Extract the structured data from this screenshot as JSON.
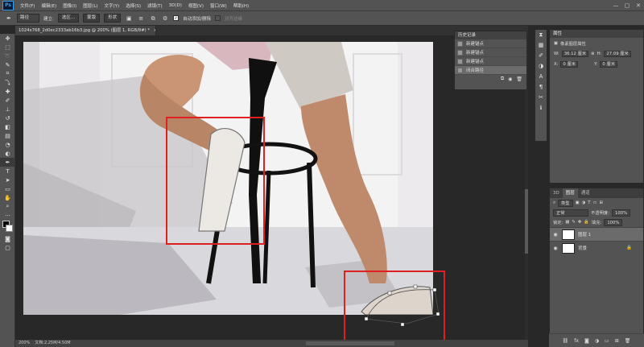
{
  "app": {
    "logo": "Ps"
  },
  "menu": [
    "文件(F)",
    "编辑(E)",
    "图像(I)",
    "图层(L)",
    "文字(Y)",
    "选择(S)",
    "滤镜(T)",
    "3D(D)",
    "视图(V)",
    "窗口(W)",
    "帮助(H)"
  ],
  "window_controls": [
    "—",
    "▢",
    "✕"
  ],
  "options": {
    "mode": "路径",
    "make_label": "建立:",
    "selection_btn": "选区...",
    "mask_btn": "蒙版",
    "shape_btn": "形状",
    "auto_add_delete": "自动添加/删除",
    "align_edges": "对齐边缘"
  },
  "document": {
    "tab_title": "1024x768_2d0ec2333ab16b3.jpg @ 200% (图层 1, RGB/8#) *",
    "tab_close": "×"
  },
  "status": {
    "zoom": "200%",
    "doc_size": "文档:2.25M/4.50M"
  },
  "history": {
    "title": "历史记录",
    "items": [
      "新建锚点",
      "新建锚点",
      "新建锚点",
      "闭合路径"
    ],
    "selected_index": 3
  },
  "properties": {
    "title": "属性",
    "subtitle": "像素图层属性",
    "w_label": "W:",
    "w_value": "36.12 厘米",
    "h_label": "H:",
    "h_value": "27.09 厘米",
    "x_label": "X:",
    "x_value": "0 厘米",
    "y_label": "Y:",
    "y_value": "0 厘米"
  },
  "layers": {
    "tabs": [
      "3D",
      "图层",
      "通道"
    ],
    "active_tab": 1,
    "filter": "类型",
    "blend_mode": "正常",
    "opacity_label": "不透明度:",
    "opacity_value": "100%",
    "lock_label": "锁定:",
    "fill_label": "填充:",
    "fill_value": "100%",
    "items": [
      {
        "name": "图层 1",
        "selected": true
      },
      {
        "name": "背景",
        "selected": false,
        "locked": true
      }
    ]
  },
  "colors": {
    "selection_box": "#e02020",
    "accent": "#2fa3f6"
  }
}
